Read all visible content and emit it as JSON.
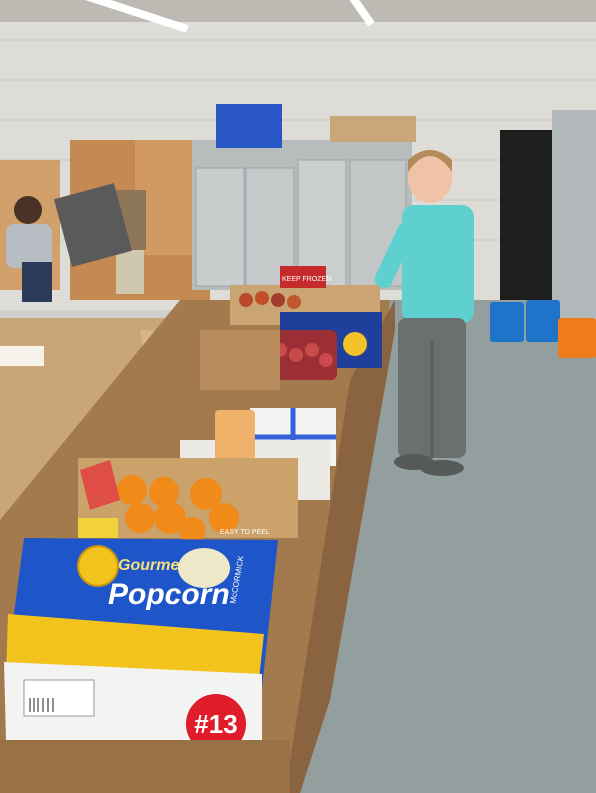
{
  "photo": {
    "signs": {
      "number_sticker": "#13",
      "popcorn_brand": "Gourmet",
      "popcorn_word": "Popcorn",
      "popcorn_maker": "McCORMICK",
      "freezer_sign": "KEEP FROZEN",
      "easy_peel": "EASY TO PEEL"
    },
    "colors": {
      "wall": "#dedcd6",
      "floor": "#8f9a9a",
      "shirt": "#5fd0d0",
      "popcorn_box": "#1e55c8",
      "oranges": "#f08a18",
      "sticker": "#e01b2a"
    }
  }
}
